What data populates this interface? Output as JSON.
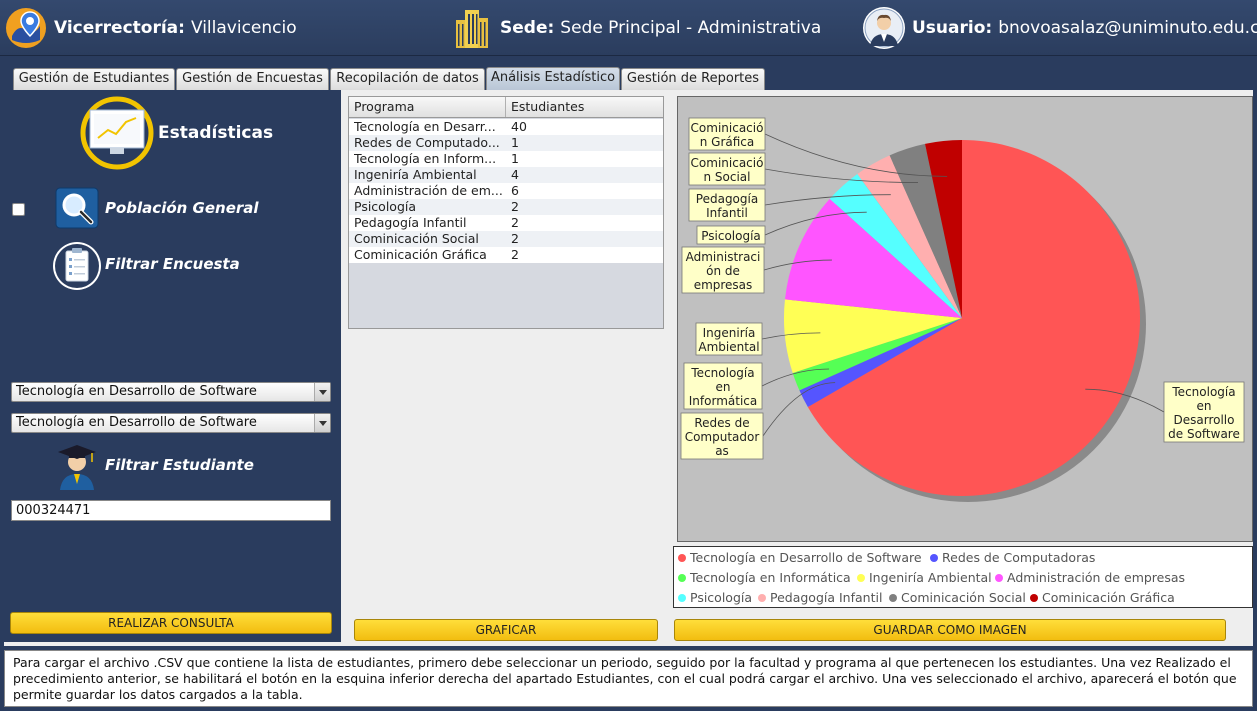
{
  "header": {
    "vicerrectoria_label": "Vicerrectoría:",
    "vicerrectoria_value": "Villavicencio",
    "sede_label": "Sede:",
    "sede_value": "Sede Principal - Administrativa",
    "usuario_label": "Usuario:",
    "usuario_value": "bnovoasalaz@uniminuto.edu.co",
    "icons": [
      "map-pin-logo-icon",
      "building-icon",
      "user-avatar-icon"
    ]
  },
  "tabs": [
    {
      "label": "Gestión de Estudiantes",
      "active": false
    },
    {
      "label": "Gestión de Encuestas",
      "active": false
    },
    {
      "label": "Recopilación de datos",
      "active": false
    },
    {
      "label": "Análisis Estadístico",
      "active": true
    },
    {
      "label": "Gestión de Reportes",
      "active": false
    }
  ],
  "left": {
    "estadisticas_title": "Estadísticas",
    "poblacion_label": "Población General",
    "filtrar_encuesta_label": "Filtrar Encuesta",
    "combo1_value": "Tecnología en Desarrollo de Software",
    "combo2_value": "Tecnología en Desarrollo de Software",
    "filtrar_estudiante_label": "Filtrar Estudiante",
    "student_id_value": "000324471",
    "realizar_button": "REALIZAR CONSULTA"
  },
  "table": {
    "headers": [
      "Programa",
      "Estudiantes"
    ],
    "rows": [
      [
        "Tecnología en Desarr...",
        "40"
      ],
      [
        "Redes de Computado...",
        "1"
      ],
      [
        "Tecnología en Inform...",
        "1"
      ],
      [
        "Ingeniría Ambiental",
        "4"
      ],
      [
        "Administración de em...",
        "6"
      ],
      [
        "Psicología",
        "2"
      ],
      [
        "Pedagogía Infantil",
        "2"
      ],
      [
        "Cominicación Social",
        "2"
      ],
      [
        "Cominicación Gráfica",
        "2"
      ]
    ]
  },
  "buttons": {
    "graficar": "GRAFICAR",
    "guardar": "GUARDAR COMO IMAGEN"
  },
  "chart_data": {
    "type": "pie",
    "series": [
      {
        "name": "Tecnología en Desarrollo de Software",
        "value": 40,
        "color": "#ff5555",
        "label_lines": [
          "Tecnología",
          "en",
          "Desarrollo",
          "de Software"
        ]
      },
      {
        "name": "Redes de Computadoras",
        "value": 1,
        "color": "#5555ff",
        "label_lines": [
          "Redes de",
          "Computador",
          "as"
        ]
      },
      {
        "name": "Tecnología en Informática",
        "value": 1,
        "color": "#55ff55",
        "label_lines": [
          "Tecnología",
          "en",
          "Informática"
        ]
      },
      {
        "name": "Ingeniría Ambiental",
        "value": 4,
        "color": "#ffff55",
        "label_lines": [
          "Ingeniría",
          "Ambiental"
        ]
      },
      {
        "name": "Administración de empresas",
        "value": 6,
        "color": "#ff55ff",
        "label_lines": [
          "Administraci",
          "ón de",
          "empresas"
        ]
      },
      {
        "name": "Psicología",
        "value": 2,
        "color": "#55ffff",
        "label_lines": [
          "Psicología"
        ]
      },
      {
        "name": "Pedagogía Infantil",
        "value": 2,
        "color": "#ffafaf",
        "label_lines": [
          "Pedagogía",
          "Infantil"
        ]
      },
      {
        "name": "Cominicación Social",
        "value": 2,
        "color": "#808080",
        "label_lines": [
          "Cominicació",
          "n Social"
        ]
      },
      {
        "name": "Cominicación Gráfica",
        "value": 2,
        "color": "#c00000",
        "label_lines": [
          "Cominicació",
          "n Gráfica"
        ]
      }
    ],
    "legend_position": "bottom"
  },
  "info": {
    "text": "Para cargar el archivo .CSV que contiene la lista de estudiantes, primero debe seleccionar un periodo, seguido por la facultad y programa al que pertenecen los estudiantes. Una vez Realizado el precedimiento anterior, se habilitará el botón en la esquina inferior derecha del apartado Estudiantes, con el cual podrá cargar el archivo. Una ves seleccionado el archivo, aparecerá el botón que permite guardar los datos cargados a la tabla."
  }
}
